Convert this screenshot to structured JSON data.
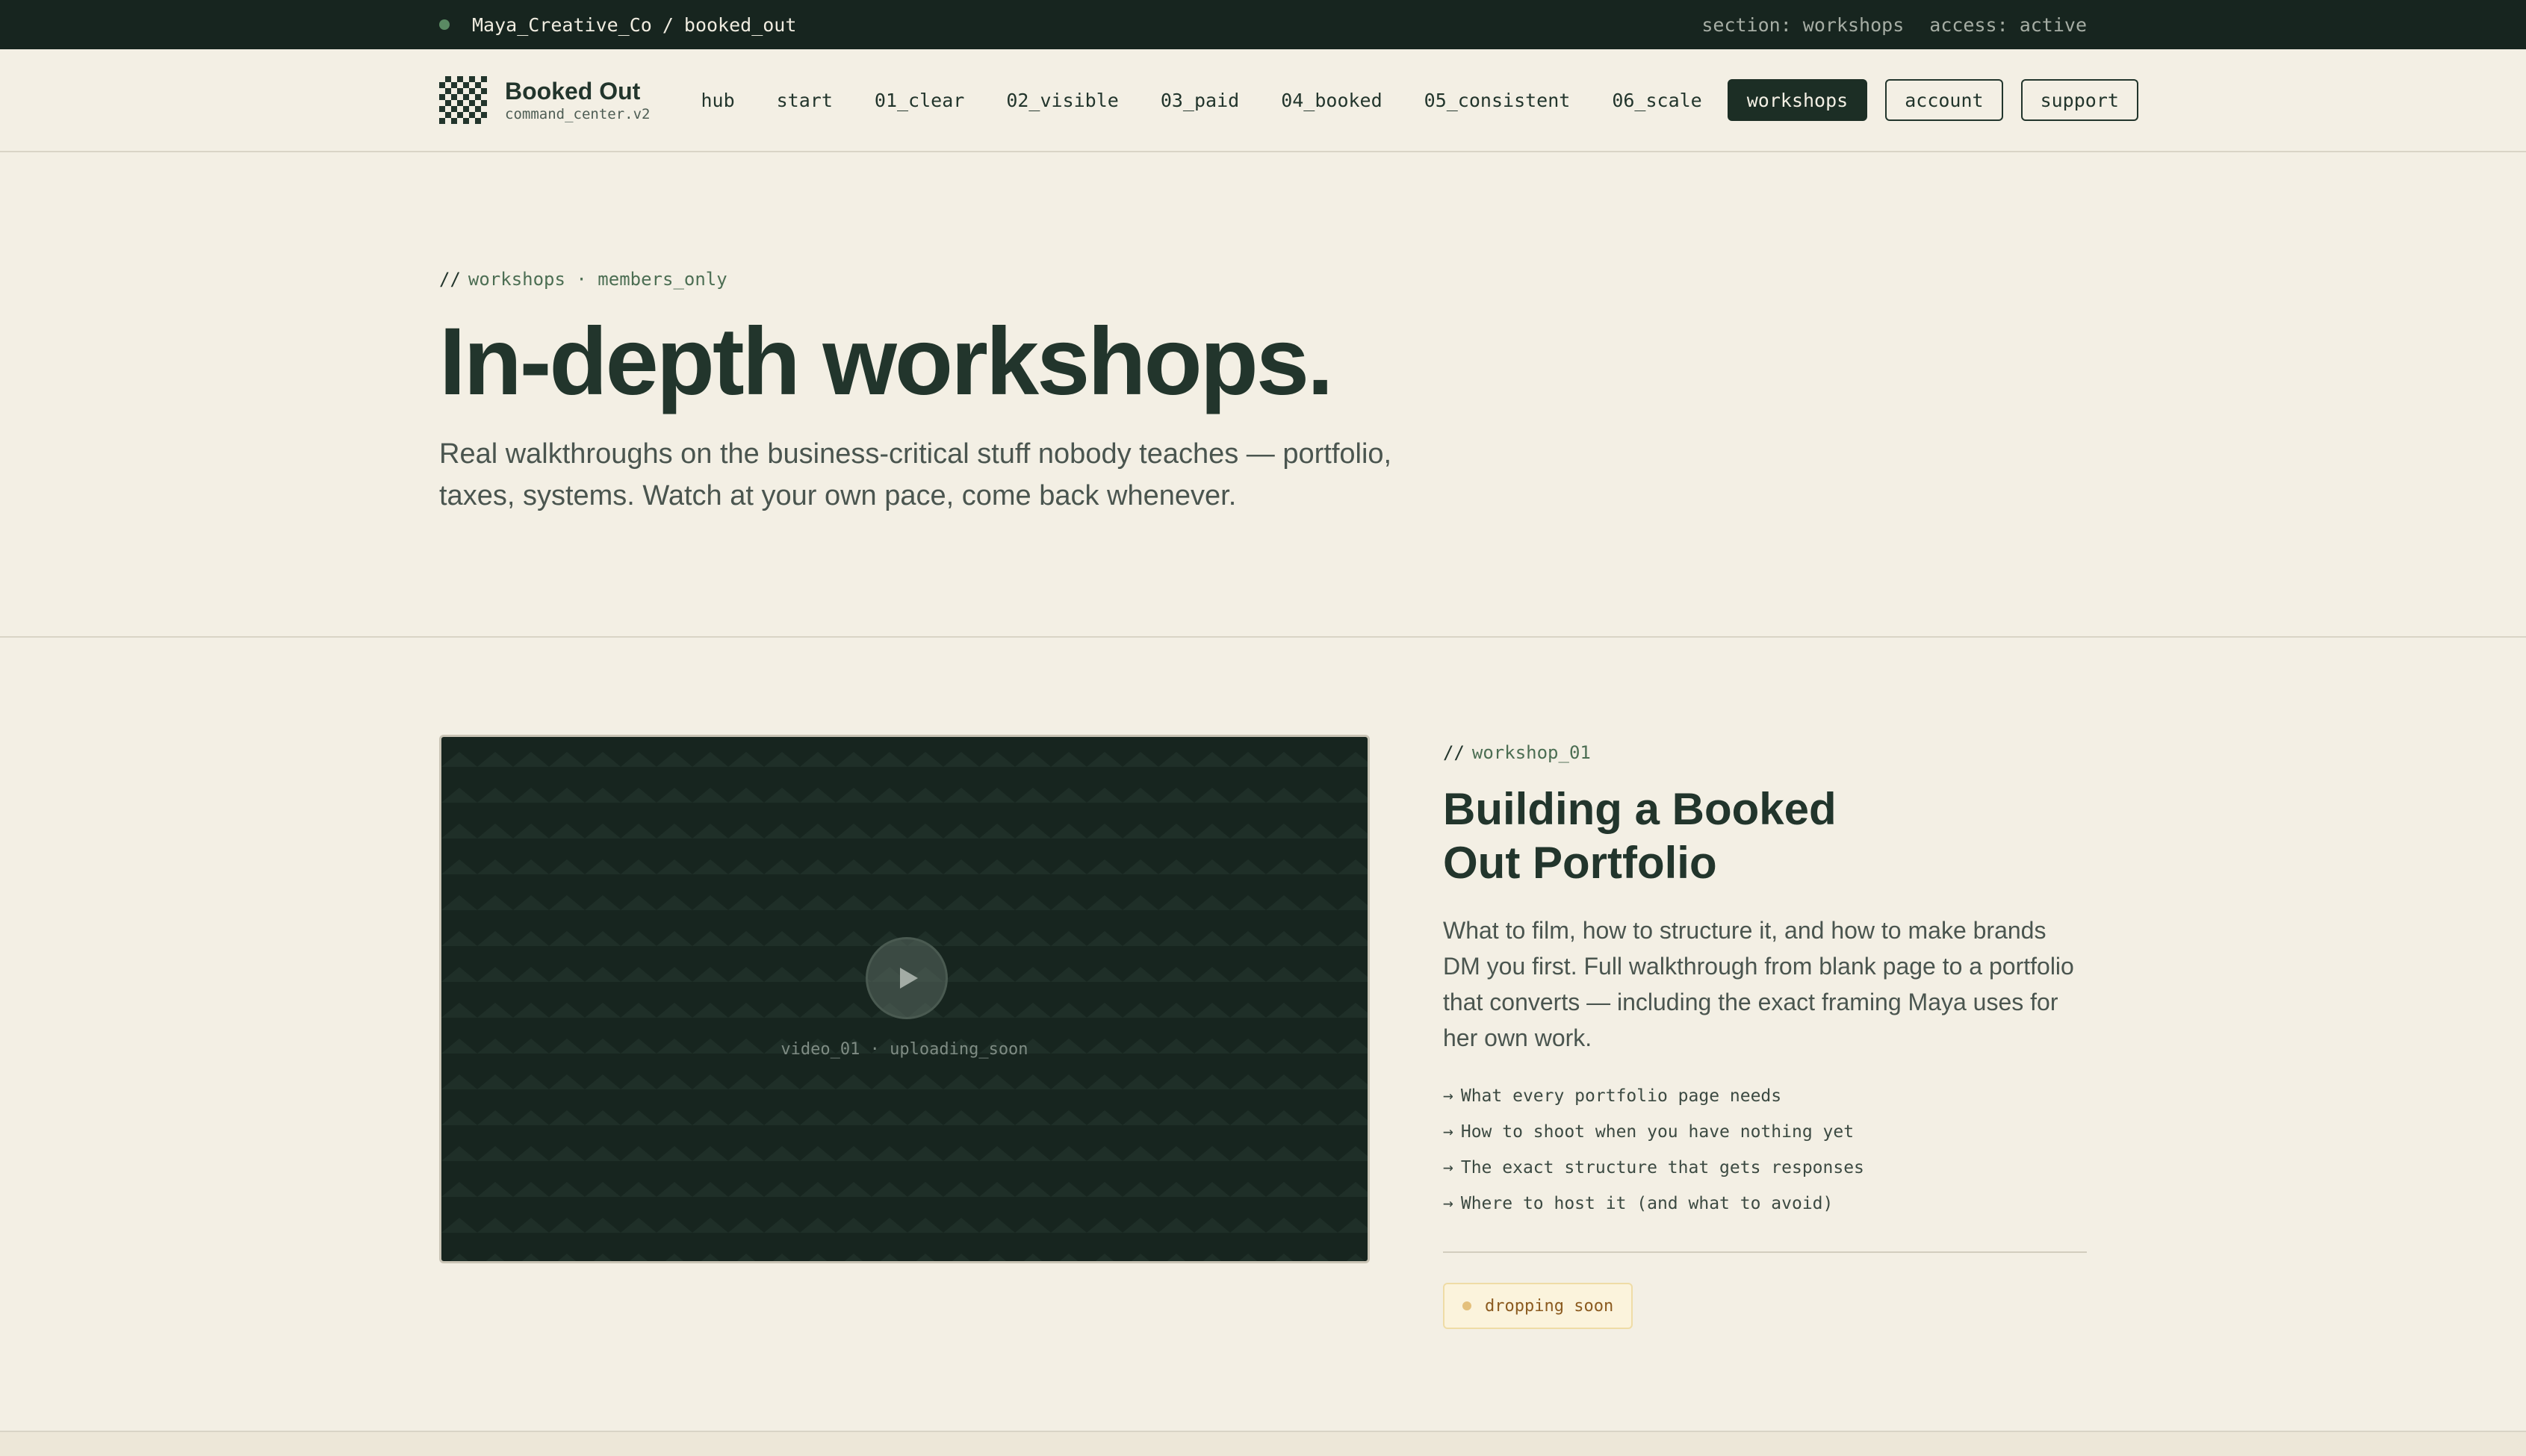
{
  "topbar": {
    "workspace": "Maya_Creative_Co",
    "separator": "/",
    "project": "booked_out",
    "section": "section: workshops",
    "access": "access: active"
  },
  "nav": {
    "brand_name": "Booked Out",
    "brand_sub": "command_center.v2",
    "links": [
      "hub",
      "start",
      "01_clear",
      "02_visible",
      "03_paid",
      "04_booked",
      "05_consistent",
      "06_scale"
    ],
    "active_button": "workshops",
    "account_button": "account",
    "support_button": "support"
  },
  "hero": {
    "eyebrow_slash": "//",
    "eyebrow": "workshops · members_only",
    "title": "In-depth workshops.",
    "subtitle": "Real walkthroughs on the business-critical stuff nobody teaches — portfolio, taxes, systems. Watch at your own pace, come back whenever."
  },
  "workshop": {
    "video_label": "video_01 · uploading_soon",
    "eyebrow_slash": "//",
    "eyebrow": "workshop_01",
    "title": "Building a Booked Out Portfolio",
    "description": "What to film, how to structure it, and how to make brands DM you first. Full walkthrough from blank page to a portfolio that converts — including the exact framing Maya uses for her own work.",
    "bullet_arrow": "→",
    "bullets": [
      "What every portfolio page needs",
      "How to shoot when you have nothing yet",
      "The exact structure that gets responses",
      "Where to host it (and what to avoid)"
    ],
    "status_badge": "dropping soon"
  },
  "icons": {
    "status_dot": "status-dot-icon",
    "logo": "checkerboard-logo-icon",
    "play": "play-icon"
  },
  "colors": {
    "ink": "#22352c",
    "background": "#f3efe4",
    "dark": "#17251f",
    "accent_green": "#4c6e53",
    "badge_bg": "#fbf3dc",
    "badge_text": "#8b5a1f"
  }
}
